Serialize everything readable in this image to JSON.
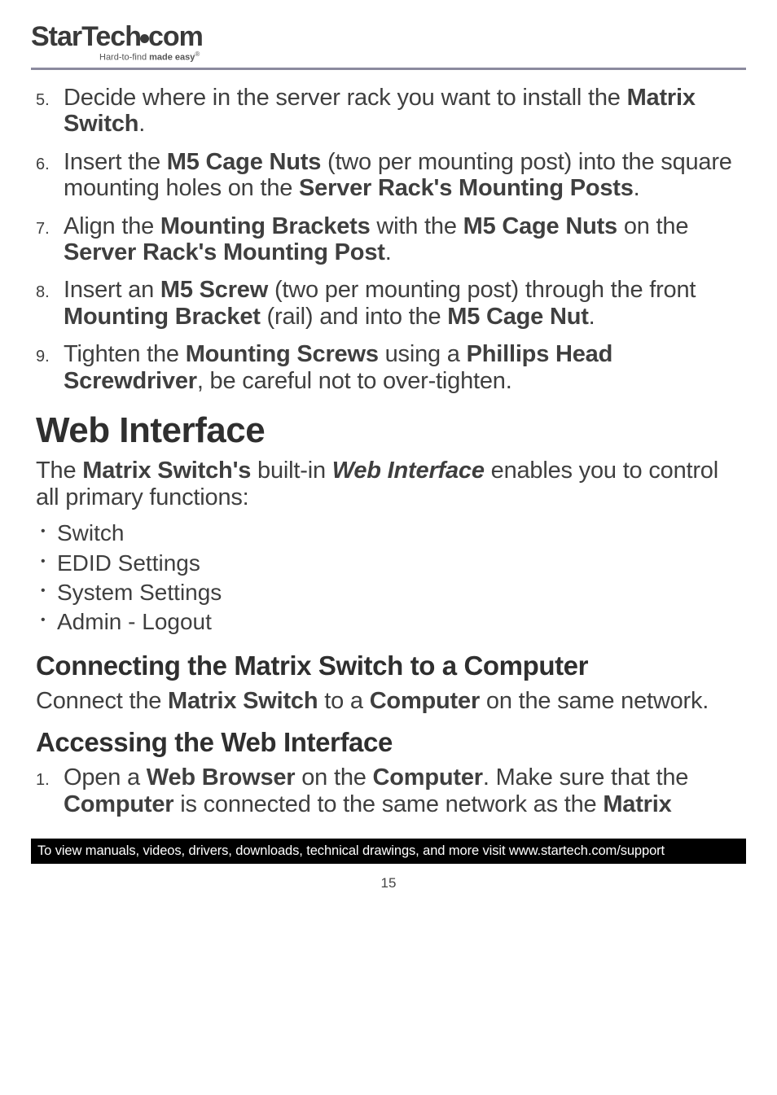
{
  "logo": {
    "part1": "StarTech",
    "part2": "com"
  },
  "tagline": {
    "prefix": "Hard-to-find ",
    "bold": "made easy",
    "reg": "®"
  },
  "steps": [
    {
      "n": "5.",
      "parts": [
        "Decide where in the server rack you want to install the ",
        {
          "b": "Matrix Switch"
        },
        "."
      ]
    },
    {
      "n": "6.",
      "parts": [
        "Insert the ",
        {
          "b": "M5 Cage Nuts"
        },
        " (two per mounting post) into the square mounting holes on the ",
        {
          "b": "Server Rack's Mounting Posts"
        },
        "."
      ]
    },
    {
      "n": "7.",
      "parts": [
        "Align the ",
        {
          "b": "Mounting Brackets"
        },
        " with the ",
        {
          "b": "M5 Cage Nuts"
        },
        " on the ",
        {
          "b": "Server Rack's Mounting Post"
        },
        "."
      ]
    },
    {
      "n": "8.",
      "parts": [
        "Insert an ",
        {
          "b": "M5 Screw"
        },
        " (two per mounting post) through the front ",
        {
          "b": "Mounting Bracket"
        },
        " (rail) and into the ",
        {
          "b": "M5 Cage Nut"
        },
        "."
      ]
    },
    {
      "n": "9.",
      "parts": [
        "Tighten the ",
        {
          "b": "Mounting Screws"
        },
        " using a ",
        {
          "b": "Phillips Head Screwdriver"
        },
        ", be careful not to over-tighten."
      ]
    }
  ],
  "h1": "Web Interface",
  "lead": [
    "The ",
    {
      "b": "Matrix Switch's"
    },
    " built-in ",
    {
      "bi": "Web Interface"
    },
    " enables you to control all primary functions:"
  ],
  "bullets": [
    "Switch",
    "EDID Settings",
    "System Settings",
    "Admin - Logout"
  ],
  "h2a": "Connecting the Matrix Switch to a Computer",
  "p_connect": [
    "Connect the ",
    {
      "b": "Matrix Switch"
    },
    " to a ",
    {
      "b": "Computer"
    },
    " on the same network."
  ],
  "h2b": "Accessing the Web Interface",
  "steps2": [
    {
      "n": "1.",
      "parts": [
        "Open a ",
        {
          "b": "Web Browser"
        },
        " on the ",
        {
          "b": "Computer"
        },
        ". Make sure that the ",
        {
          "b": "Computer"
        },
        " is connected to the same network as the ",
        {
          "b": "Matrix"
        }
      ]
    }
  ],
  "footer": "To view manuals, videos, drivers, downloads, technical drawings, and more visit www.startech.com/support",
  "page_num": "15"
}
